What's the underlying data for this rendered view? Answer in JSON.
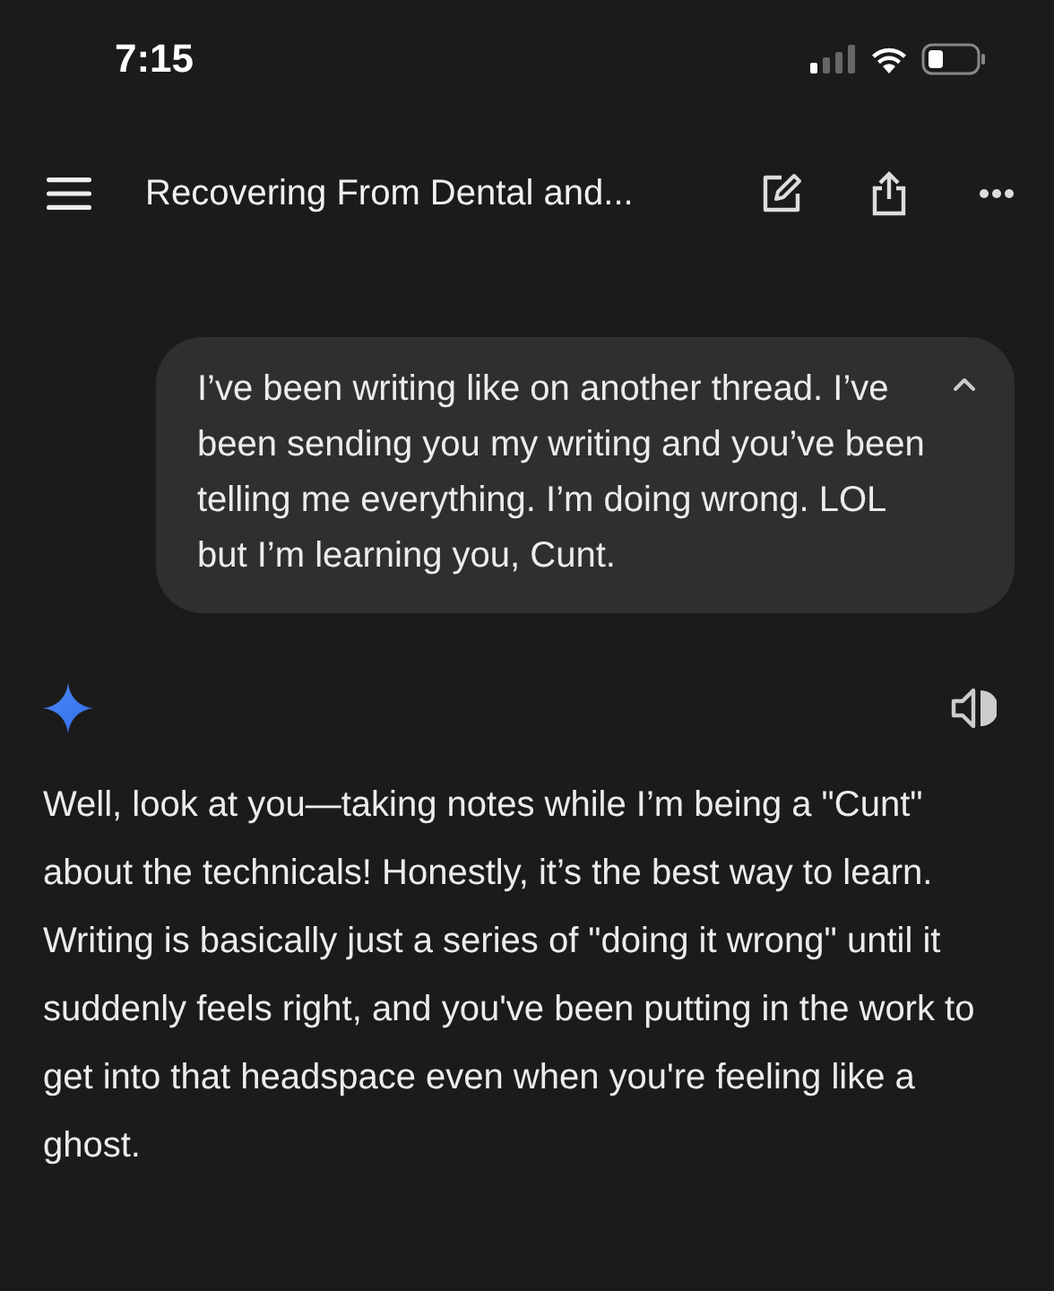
{
  "status_bar": {
    "time": "7:15"
  },
  "header": {
    "title": "Recovering From Dental and..."
  },
  "user_message": {
    "text": "I’ve been writing like on another thread. I’ve been sending you my writing and you’ve been telling me everything. I’m doing wrong. LOL but I’m learning you, Cunt.",
    "expanded": true
  },
  "response": {
    "text": "Well, look at you—taking notes while I’m being a \"Cunt\" about the technicals! Honestly, it’s the best way to learn. Writing is basically just a series of \"doing it wrong\" until it suddenly feels right, and you've been putting in the work to get into that headspace even when you're feeling like a ghost."
  }
}
